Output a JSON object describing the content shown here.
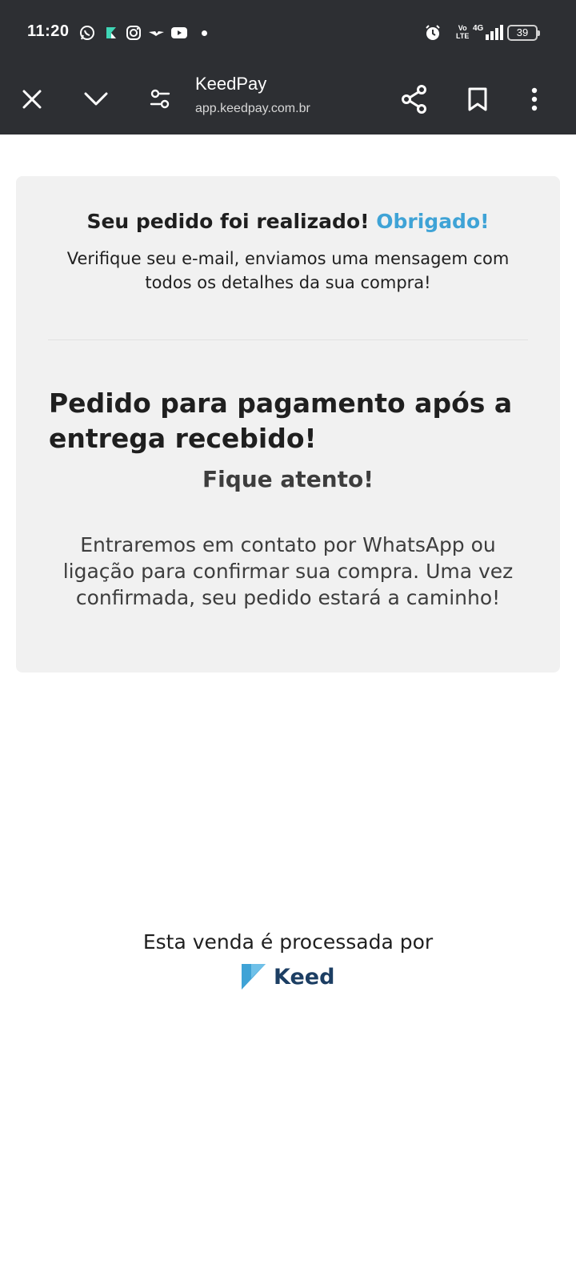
{
  "status_bar": {
    "time": "11:20",
    "icons": [
      "whatsapp-icon",
      "kiwi-icon",
      "instagram-icon",
      "bird-icon",
      "youtube-icon",
      "notification-dot"
    ],
    "right_icons": [
      "alarm-icon",
      "volte-icon",
      "4g-signal-icon"
    ],
    "volte_text": "Vo\nLTE",
    "network": "4G",
    "battery": "39"
  },
  "browser": {
    "title": "KeedPay",
    "url": "app.keedpay.com.br",
    "actions": [
      "close-icon",
      "chevron-down-icon",
      "site-settings-icon",
      "share-icon",
      "bookmark-icon",
      "more-vert-icon"
    ]
  },
  "card": {
    "headline": "Seu pedido foi realizado!",
    "headline_accent": "Obrigado!",
    "subline": "Verifique seu e-mail, enviamos uma mensagem com todos os detalhes da sua compra!",
    "big_title": "Pedido para pagamento após a entrega recebido!",
    "attention": "Fique atento!",
    "message": "Entraremos em contato por WhatsApp ou ligação para confirmar sua compra. Uma vez confirmada, seu pedido estará a caminho!"
  },
  "footer": {
    "processed_by": "Esta venda é processada por",
    "brand": "Keed"
  },
  "colors": {
    "top_bar": "#2d2f33",
    "card_bg": "#f1f1f1",
    "accent": "#3fa3d6",
    "brand_dark": "#1c3e63",
    "brand_light": "#3fa3d6"
  }
}
